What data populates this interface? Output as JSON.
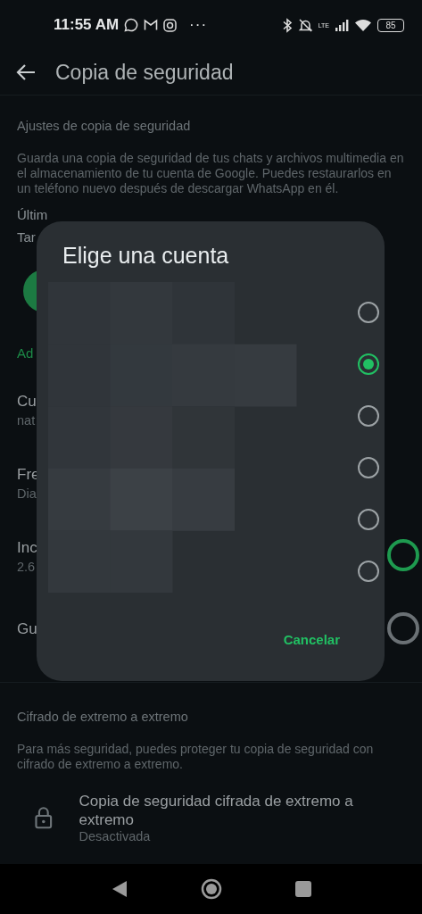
{
  "status_bar": {
    "time": "11:55 AM",
    "more": "···",
    "network": "LTE",
    "battery": "85"
  },
  "toolbar": {
    "title": "Copia de seguridad"
  },
  "backup_settings": {
    "header": "Ajustes de copia de seguridad",
    "description": "Guarda una copia de seguridad de tus chats y archivos multimedia en el almacenamiento de tu cuenta de Google. Puedes restaurarlos en un teléfono nuevo después de descargar WhatsApp en él.",
    "last_backup": "Últim",
    "size": "Tar",
    "manage_link": "Ad",
    "items": [
      {
        "kind": "plain",
        "title": "Cu",
        "subtitle": "nat"
      },
      {
        "kind": "plain",
        "title": "Fre",
        "subtitle": "Dia"
      },
      {
        "kind": "switch",
        "title": "Inc",
        "subtitle": "2.6",
        "on": true
      },
      {
        "kind": "switch",
        "title": "Gu",
        "on": false
      }
    ]
  },
  "encryption": {
    "header": "Cifrado de extremo a extremo",
    "description": "Para más seguridad, puedes proteger tu copia de seguridad con cifrado de extremo a extremo.",
    "item_title": "Copia de seguridad cifrada de extremo a extremo",
    "item_subtitle": "Desactivada"
  },
  "dialog": {
    "title": "Elige una cuenta",
    "options": [
      {
        "selected": false
      },
      {
        "selected": true
      },
      {
        "selected": false
      },
      {
        "selected": false
      },
      {
        "selected": false
      },
      {
        "selected": false
      }
    ],
    "cancel": "Cancelar"
  }
}
